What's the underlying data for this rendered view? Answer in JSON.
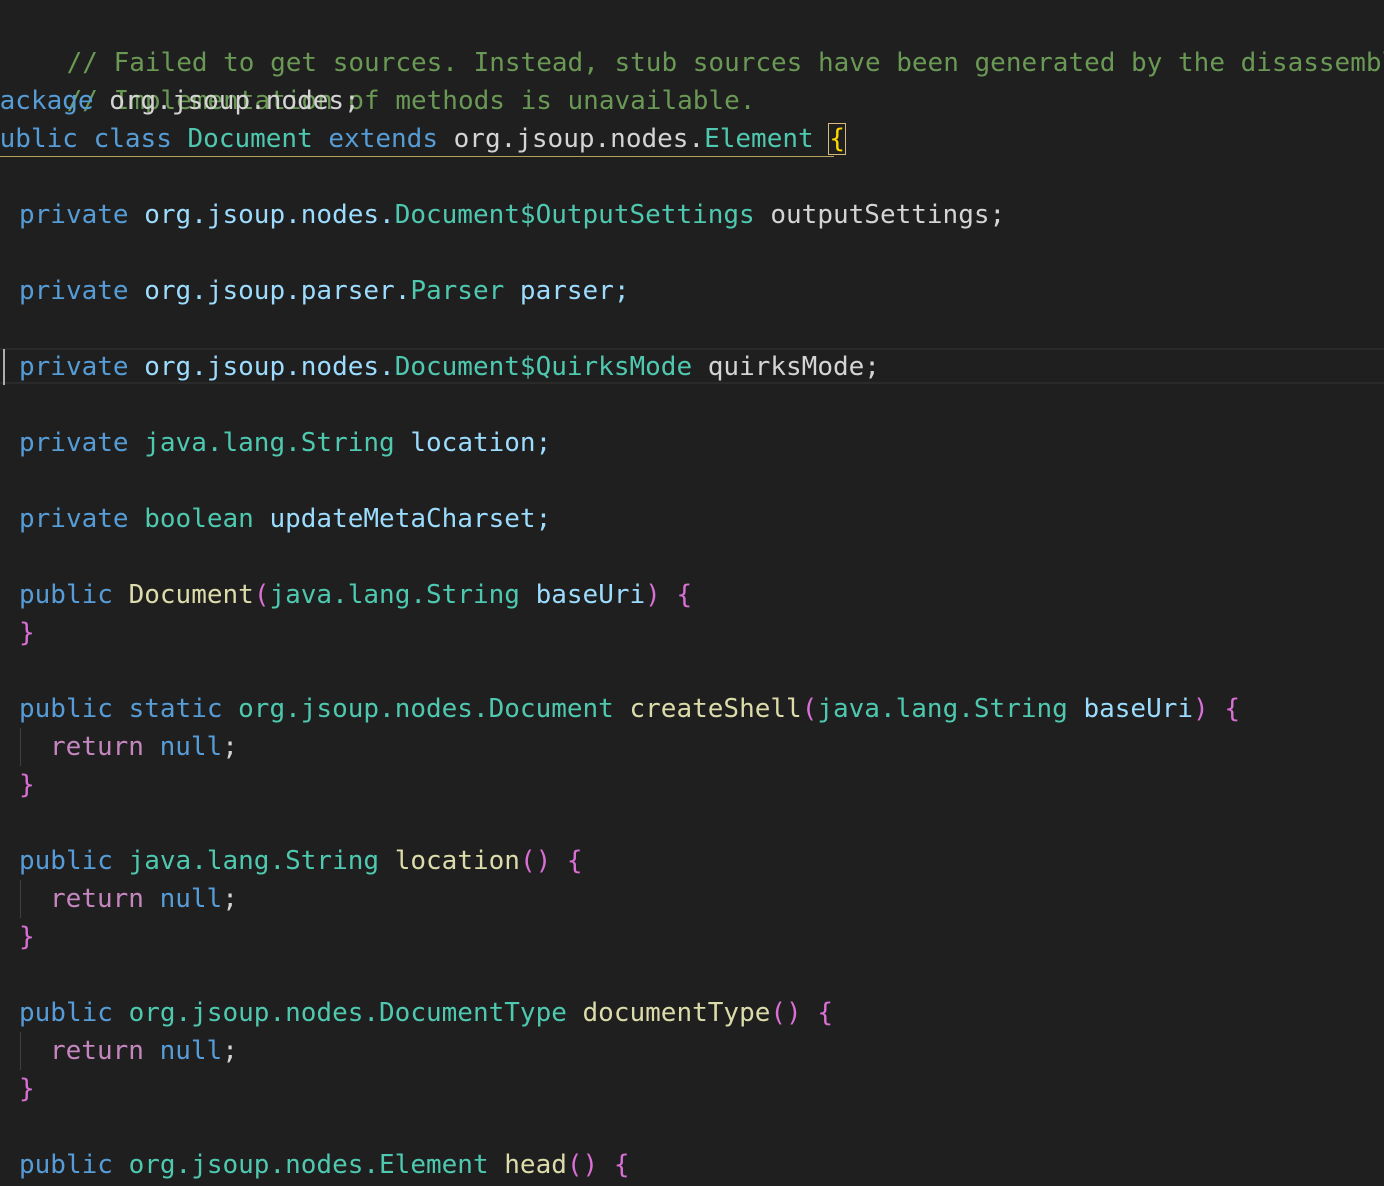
{
  "editor": {
    "language": "java",
    "theme": "dark",
    "lines": {
      "comment1": "// Failed to get sources. Instead, stub sources have been generated by the disassembler.",
      "comment2": "// Implementation of methods is unavailable.",
      "package_kw": "package",
      "package_name": "org.jsoup.nodes;",
      "class_public": "public",
      "class_kw": "class",
      "class_name": "Document",
      "class_extends": "extends",
      "class_super_pkg": "org.jsoup.nodes.",
      "class_super": "Element",
      "open_brace": "{",
      "close_brace": "}",
      "f1_mod": "private",
      "f1_type_pkg": "org.jsoup.nodes.",
      "f1_type": "Document$OutputSettings",
      "f1_name": "outputSettings;",
      "f2_mod": "private",
      "f2_type_pkg": "org.jsoup.parser.",
      "f2_type": "Parser",
      "f2_name": "parser;",
      "f3_mod": "private",
      "f3_type_pkg": "org.jsoup.nodes.",
      "f3_type": "Document$QuirksMode",
      "f3_name": "quirksMode;",
      "f4_mod": "private",
      "f4_type_pkg": "java.lang.",
      "f4_type": "String",
      "f4_name": "location;",
      "f5_mod": "private",
      "f5_type": "boolean",
      "f5_name": "updateMetaCharset;",
      "m1_mod": "public",
      "m1_name": "Document",
      "m1_param_pkg": "java.lang.",
      "m1_param_type": "String",
      "m1_param_name": "baseUri",
      "m2_mod": "public",
      "m2_static": "static",
      "m2_ret_pkg": "org.jsoup.nodes.",
      "m2_ret": "Document",
      "m2_name": "createShell",
      "m2_param_pkg": "java.lang.",
      "m2_param_type": "String",
      "m2_param_name": "baseUri",
      "return_kw": "return",
      "null_kw": "null",
      "semicolon": ";",
      "m3_mod": "public",
      "m3_ret_pkg": "java.lang.",
      "m3_ret": "String",
      "m3_name": "location",
      "m4_mod": "public",
      "m4_ret_pkg": "org.jsoup.nodes.",
      "m4_ret": "DocumentType",
      "m4_name": "documentType",
      "m5_mod": "public",
      "m5_ret_pkg": "org.jsoup.nodes.",
      "m5_ret": "Element",
      "m5_name": "head"
    }
  },
  "colors": {
    "background": "#1f1f1f",
    "comment": "#6a9955",
    "keyword": "#569cd6",
    "control": "#c586c0",
    "type": "#4ec9b0",
    "identifier": "#9cdcfe",
    "function": "#dcdcaa",
    "bracket_level1": "#ffd700",
    "bracket_level2": "#da70d6"
  }
}
